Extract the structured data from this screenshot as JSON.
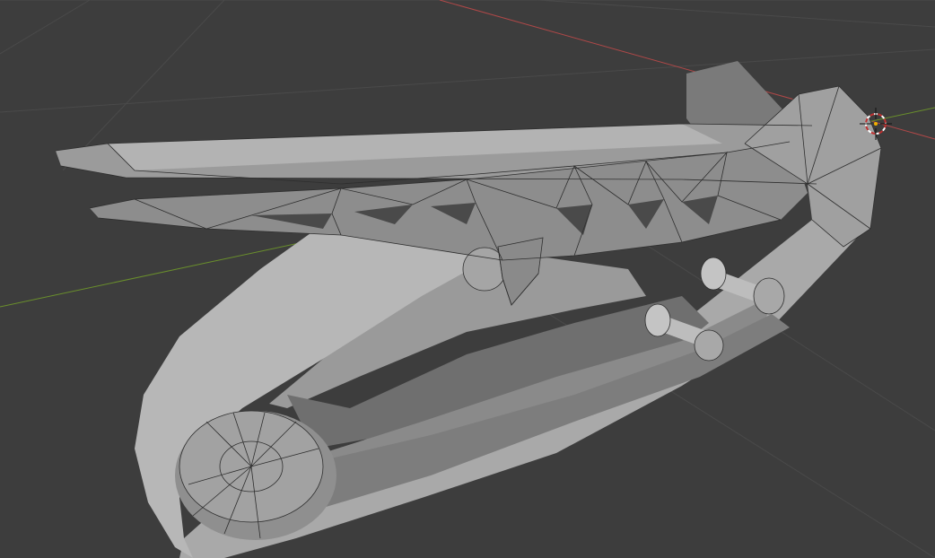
{
  "viewport": {
    "background": "#3d3d3d",
    "grid_color": "#4a4a4a",
    "x_axis_color": "#b04848",
    "y_axis_color": "#6a8f2c",
    "mesh_light": "#b9b9b9",
    "mesh_mid": "#9a9a9a",
    "mesh_dark": "#7a7a7a",
    "mesh_shadow": "#6d6d6d",
    "edge_color": "#2e2e2e",
    "cursor_icon": "3d-cursor-icon"
  }
}
